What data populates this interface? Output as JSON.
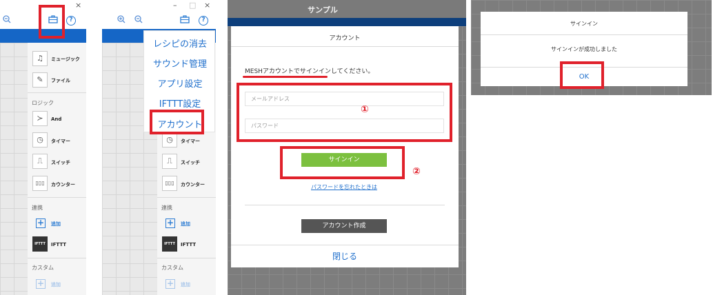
{
  "panel1": {
    "close_glyph": "×",
    "palette": {
      "items_top": [
        {
          "icon": "music-note-icon",
          "label": "ミュージック"
        },
        {
          "icon": "file-icon",
          "label": "ファイル"
        }
      ],
      "logic_title": "ロジック",
      "logic_items": [
        {
          "icon": "and-icon",
          "label": "And"
        },
        {
          "icon": "timer-icon",
          "label": "タイマー"
        },
        {
          "icon": "switch-icon",
          "label": "スイッチ"
        },
        {
          "icon": "counter-icon",
          "label": "カウンター"
        }
      ],
      "link_title": "連携",
      "add_label": "追加",
      "ifttt_icon_text": "IFTTT",
      "ifttt_label": "IFTTT",
      "custom_title": "カスタム",
      "custom_add_label": "追加"
    }
  },
  "panel2": {
    "window_controls": [
      "–",
      "□",
      "×"
    ],
    "menu_items": [
      "レシピの消去",
      "サウンド管理",
      "アプリ設定",
      "IFTTT設定",
      "アカウント"
    ],
    "palette": {
      "items": [
        {
          "icon": "timer-icon",
          "label": "タイマー"
        },
        {
          "icon": "switch-icon",
          "label": "スイッチ"
        },
        {
          "icon": "counter-icon",
          "label": "カウンター"
        }
      ],
      "link_title": "連携",
      "add_label": "追加",
      "ifttt_icon_text": "IFTTT",
      "ifttt_label": "IFTTT",
      "custom_title": "カスタム",
      "custom_add_label": "追加"
    }
  },
  "panel3": {
    "window_title": "サンプル",
    "dialog_title": "アカウント",
    "instruction": "MESHアカウントでサインインしてください。",
    "email_placeholder": "メールアドレス",
    "password_placeholder": "パスワード",
    "marker_1": "①",
    "marker_2": "②",
    "signin_label": "サインイン",
    "forgot_link": "パスワードを忘れたときは",
    "create_account_label": "アカウント作成",
    "close_label": "閉じる"
  },
  "panel4": {
    "dialog_title": "サインイン",
    "message": "サインインが成功しました",
    "ok_label": "OK"
  },
  "colors": {
    "highlight": "#e0212b",
    "header_blue": "#1566c6",
    "link_blue": "#1f6fcc",
    "green_button": "#7cc03f"
  }
}
